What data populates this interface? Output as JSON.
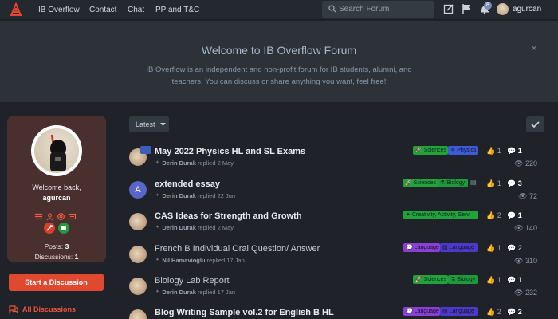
{
  "header": {
    "nav": [
      "IB Overflow",
      "Contact",
      "Chat",
      "PP and T&C"
    ],
    "search_placeholder": "Search Forum",
    "notification_count": "8",
    "username": "agurcan"
  },
  "hero": {
    "title": "Welcome to IB Overflow Forum",
    "text": "IB Overflow is an independent and non-profit forum for IB students, alumni, and teachers. You can discuss or share anything you want, feel free!",
    "close": "×"
  },
  "sidebar": {
    "welcome": "Welcome back,",
    "name": "agurcan",
    "posts_label": "Posts:",
    "posts_value": "3",
    "discussions_label": "Discussions:",
    "discussions_value": "1",
    "start_button": "Start a Discussion",
    "all_discussions": "All Discussions"
  },
  "toolbar": {
    "sort": "Latest"
  },
  "discussions": [
    {
      "title": "May 2022 Physics HL and SL Exams",
      "user": "Derin Durak",
      "action": "replied 2 May",
      "tags": [
        "Sciences",
        "Physics"
      ],
      "likes": "1",
      "replies": "1",
      "views": "220"
    },
    {
      "title": "extended essay",
      "user": "Derin Durak",
      "action": "replied 22 Jun",
      "tags": [
        "Sciences",
        "Biology"
      ],
      "likes": "1",
      "replies": "3",
      "views": "72",
      "avatar_letter": "A"
    },
    {
      "title": "CAS Ideas for Strength and Growth",
      "user": "Derin Durak",
      "action": "replied 2 May",
      "tags": [
        "Creativity, Activity, Servi"
      ],
      "likes": "2",
      "replies": "1",
      "views": "140"
    },
    {
      "title": "French B Individual Oral Question/ Answer",
      "user": "Nil Hamavioğlu",
      "action": "replied 17 Jan",
      "tags": [
        "Language",
        "Language"
      ],
      "likes": "1",
      "replies": "2",
      "views": "310"
    },
    {
      "title": "Biology Lab Report",
      "user": "Derin Durak",
      "action": "replied 17 Jan",
      "tags": [
        "Sciences",
        "Biology"
      ],
      "likes": "1",
      "replies": "1",
      "views": "232"
    },
    {
      "title": "Blog Writing Sample vol.2 for English B HL",
      "user": "",
      "action": "",
      "tags": [
        "Language",
        "Language"
      ],
      "likes": "2",
      "replies": "2",
      "views": ""
    }
  ],
  "colors": {
    "sciences": "#1fa33a",
    "physics": "#3d5bd9",
    "biology": "#1f9a3a",
    "cas": "#1fa33a",
    "language_a": "#8a3fd6",
    "language_b": "#4b3ac9",
    "accent": "#e0482f"
  }
}
